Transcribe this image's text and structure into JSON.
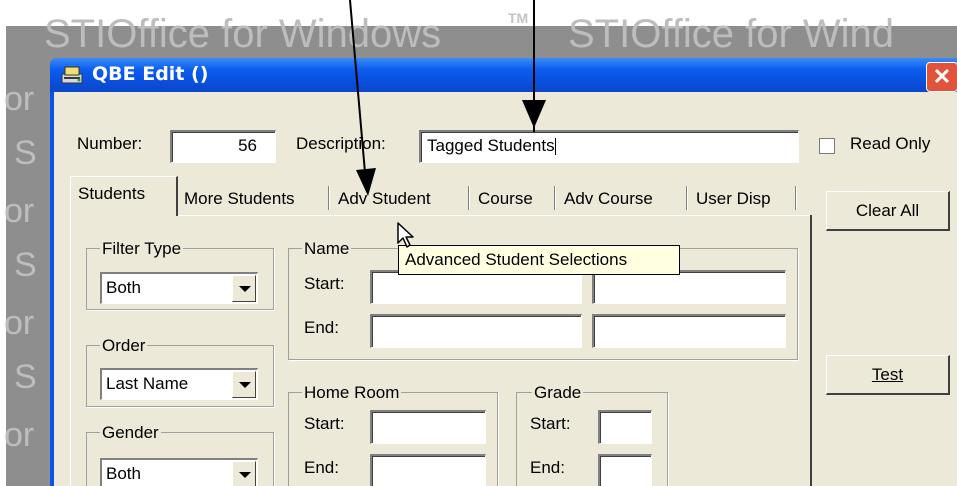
{
  "watermark": {
    "text_left": "STIOffice for Windows",
    "trademark": "TM",
    "text_right": "STIOffice for Wind",
    "side_glyph": "or",
    "side_letter": "S"
  },
  "window": {
    "title": "QBE Edit  ()",
    "close_glyph": "✕"
  },
  "header": {
    "number_label": "Number:",
    "number_value": "56",
    "description_label": "Description:",
    "description_value": "Tagged Students",
    "read_only_label": "Read Only"
  },
  "tabs": [
    {
      "label": "Students",
      "active": true
    },
    {
      "label": "More Students",
      "active": false
    },
    {
      "label": "Adv Student",
      "active": false
    },
    {
      "label": "Course",
      "active": false
    },
    {
      "label": "Adv Course",
      "active": false
    },
    {
      "label": "User Disp",
      "active": false
    }
  ],
  "buttons": {
    "clear_all": "Clear All",
    "test": "Test"
  },
  "filter_type": {
    "label": "Filter Type",
    "value": "Both"
  },
  "order": {
    "label": "Order",
    "value": "Last Name"
  },
  "gender": {
    "label": "Gender",
    "value": "Both"
  },
  "name_group": {
    "label": "Name",
    "start_label": "Start:",
    "end_label": "End:"
  },
  "home_room": {
    "label": "Home Room",
    "start_label": "Start:",
    "end_label": "End:"
  },
  "grade": {
    "label": "Grade",
    "start_label": "Start:",
    "end_label": "End:"
  },
  "tooltip": "Advanced Student Selections",
  "colors": {
    "title_bar": "#0a54e3",
    "dialog_face": "#ece9d8",
    "tooltip_bg": "#ffffe1",
    "close_button": "#e2533b"
  }
}
